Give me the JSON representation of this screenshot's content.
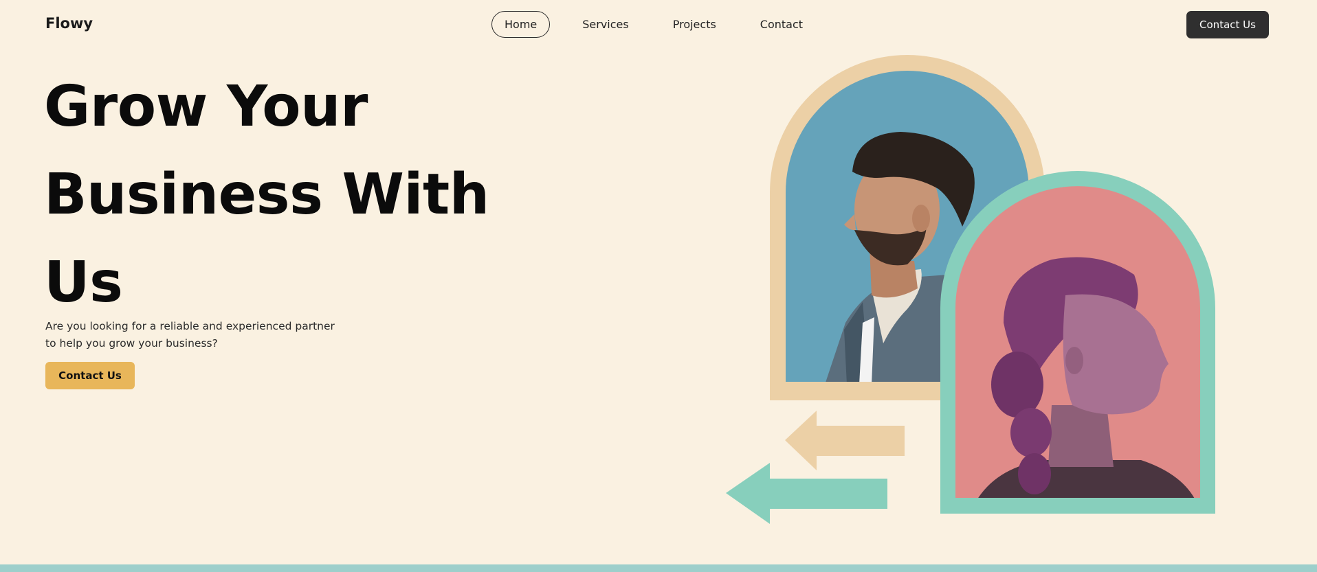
{
  "brand": {
    "name": "Flowy"
  },
  "nav": {
    "items": [
      {
        "label": "Home",
        "active": true
      },
      {
        "label": "Services",
        "active": false
      },
      {
        "label": "Projects",
        "active": false
      },
      {
        "label": "Contact",
        "active": false
      }
    ],
    "cta_label": "Contact Us"
  },
  "hero": {
    "headline_lines": [
      "Grow Your",
      "Business With",
      "Us"
    ],
    "subtext_line1": "Are you looking for a reliable and experienced partner",
    "subtext_line2": "to help you grow your business?",
    "cta_label": "Contact Us"
  },
  "colors": {
    "background": "#faf1e1",
    "accent_yellow": "#e8b65a",
    "dark_button": "#2f2f2f",
    "sand": "#ecd0a6",
    "teal": "#87cfbc",
    "blue_panel": "#65a3ba",
    "pink_panel": "#e08b89",
    "bottom_band": "#9dcfcb"
  },
  "illustration": {
    "portraits": [
      "man-profile-portrait",
      "woman-profile-portrait"
    ],
    "arrows": [
      "sand-arrow-left-icon",
      "teal-arrow-left-icon"
    ]
  }
}
